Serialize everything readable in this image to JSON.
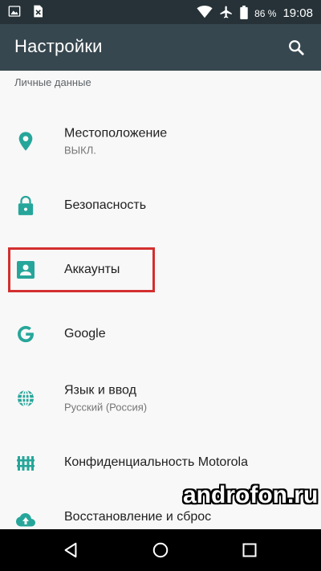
{
  "status_bar": {
    "battery_percent": "86 %",
    "time": "19:08"
  },
  "app_bar": {
    "title": "Настройки"
  },
  "section_header": "Личные данные",
  "rows": [
    {
      "title": "Местоположение",
      "subtitle": "ВЫКЛ.",
      "icon": "location-icon"
    },
    {
      "title": "Безопасность",
      "subtitle": "",
      "icon": "lock-icon"
    },
    {
      "title": "Аккаунты",
      "subtitle": "",
      "icon": "account-icon"
    },
    {
      "title": "Google",
      "subtitle": "",
      "icon": "google-icon"
    },
    {
      "title": "Язык и ввод",
      "subtitle": "Русский (Россия)",
      "icon": "globe-icon"
    },
    {
      "title": "Конфиденциальность Motorola",
      "subtitle": "",
      "icon": "privacy-fence-icon"
    },
    {
      "title": "Восстановление и сброс",
      "subtitle": "",
      "icon": "backup-icon"
    }
  ],
  "watermark": "androfon.ru",
  "colors": {
    "status_bar": "#263238",
    "app_bar": "#37474f",
    "accent": "#26a69a",
    "highlight": "#d32f2f"
  }
}
